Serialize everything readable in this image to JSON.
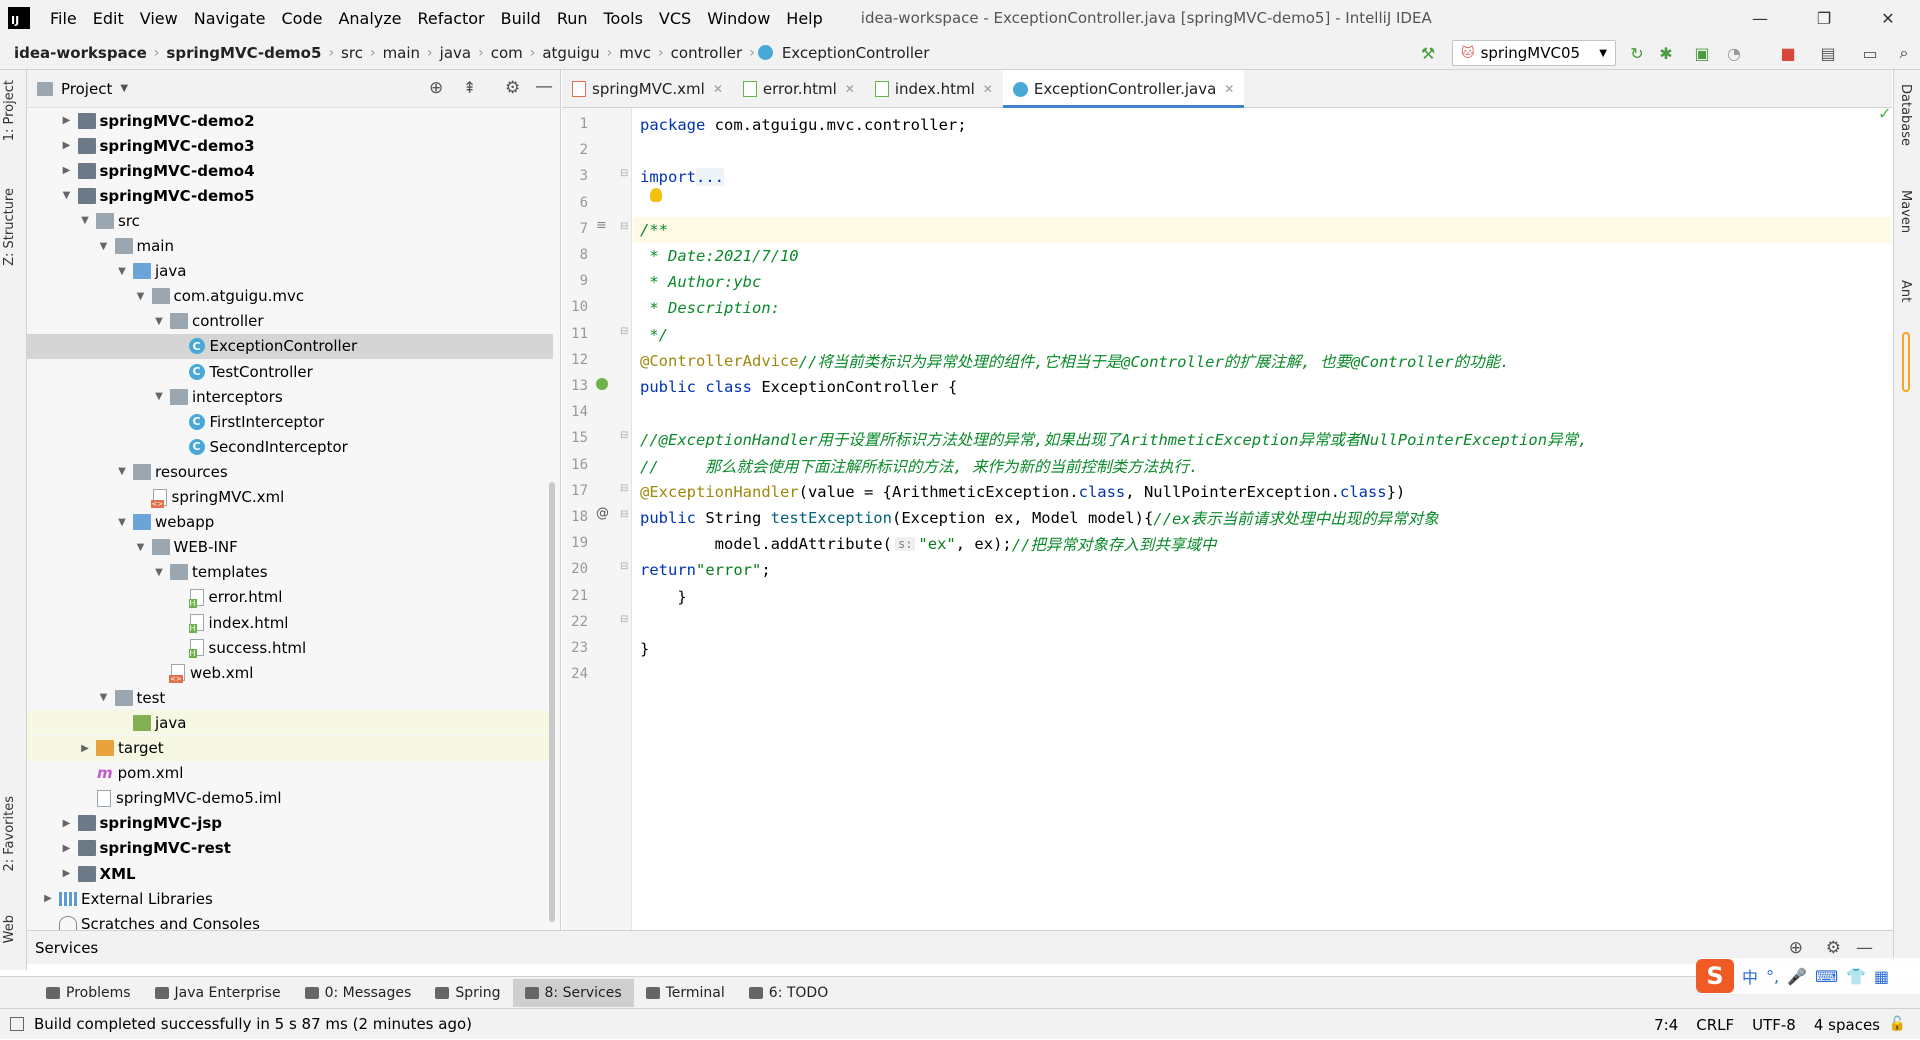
{
  "menubar": {
    "items": [
      "File",
      "Edit",
      "View",
      "Navigate",
      "Code",
      "Analyze",
      "Refactor",
      "Build",
      "Run",
      "Tools",
      "VCS",
      "Window",
      "Help"
    ],
    "title": "idea-workspace - ExceptionController.java [springMVC-demo5] - IntelliJ IDEA",
    "minimize": "—",
    "restore": "❐",
    "close": "✕"
  },
  "breadcrumb": [
    "idea-workspace",
    "springMVC-demo5",
    "src",
    "main",
    "java",
    "com",
    "atguigu",
    "mvc",
    "controller",
    "ExceptionController"
  ],
  "run_config": "springMVC05",
  "project_panel": {
    "title": "Project",
    "tree": [
      {
        "label": "springMVC-demo2",
        "type": "module",
        "depth": 0,
        "arrow": "right",
        "bold": true
      },
      {
        "label": "springMVC-demo3",
        "type": "module",
        "depth": 0,
        "arrow": "right",
        "bold": true
      },
      {
        "label": "springMVC-demo4",
        "type": "module",
        "depth": 0,
        "arrow": "right",
        "bold": true
      },
      {
        "label": "springMVC-demo5",
        "type": "module",
        "depth": 0,
        "arrow": "down",
        "bold": true
      },
      {
        "label": "src",
        "type": "folder",
        "depth": 1,
        "arrow": "down"
      },
      {
        "label": "main",
        "type": "folder",
        "depth": 2,
        "arrow": "down"
      },
      {
        "label": "java",
        "type": "folder-blue",
        "depth": 3,
        "arrow": "down"
      },
      {
        "label": "com.atguigu.mvc",
        "type": "folder",
        "depth": 4,
        "arrow": "down"
      },
      {
        "label": "controller",
        "type": "folder",
        "depth": 5,
        "arrow": "down"
      },
      {
        "label": "ExceptionController",
        "type": "class",
        "depth": 6,
        "arrow": "",
        "selected": true
      },
      {
        "label": "TestController",
        "type": "class",
        "depth": 6,
        "arrow": ""
      },
      {
        "label": "interceptors",
        "type": "folder",
        "depth": 5,
        "arrow": "down"
      },
      {
        "label": "FirstInterceptor",
        "type": "class",
        "depth": 6,
        "arrow": ""
      },
      {
        "label": "SecondInterceptor",
        "type": "class",
        "depth": 6,
        "arrow": ""
      },
      {
        "label": "resources",
        "type": "folder",
        "depth": 3,
        "arrow": "down"
      },
      {
        "label": "springMVC.xml",
        "type": "xml",
        "depth": 4,
        "arrow": ""
      },
      {
        "label": "webapp",
        "type": "folder-blue",
        "depth": 3,
        "arrow": "down"
      },
      {
        "label": "WEB-INF",
        "type": "folder",
        "depth": 4,
        "arrow": "down"
      },
      {
        "label": "templates",
        "type": "folder",
        "depth": 5,
        "arrow": "down"
      },
      {
        "label": "error.html",
        "type": "html",
        "depth": 6,
        "arrow": ""
      },
      {
        "label": "index.html",
        "type": "html",
        "depth": 6,
        "arrow": ""
      },
      {
        "label": "success.html",
        "type": "html",
        "depth": 6,
        "arrow": ""
      },
      {
        "label": "web.xml",
        "type": "xml",
        "depth": 5,
        "arrow": ""
      },
      {
        "label": "test",
        "type": "folder",
        "depth": 2,
        "arrow": "down"
      },
      {
        "label": "java",
        "type": "folder-green",
        "depth": 3,
        "arrow": "",
        "highlight": true
      },
      {
        "label": "target",
        "type": "folder-orange",
        "depth": 1,
        "arrow": "right",
        "highlight": true
      },
      {
        "label": "pom.xml",
        "type": "maven",
        "depth": 1,
        "arrow": ""
      },
      {
        "label": "springMVC-demo5.iml",
        "type": "file",
        "depth": 1,
        "arrow": ""
      },
      {
        "label": "springMVC-jsp",
        "type": "module",
        "depth": 0,
        "arrow": "right",
        "bold": true
      },
      {
        "label": "springMVC-rest",
        "type": "module",
        "depth": 0,
        "arrow": "right",
        "bold": true
      },
      {
        "label": "XML",
        "type": "module",
        "depth": 0,
        "arrow": "right",
        "bold": true
      },
      {
        "label": "External Libraries",
        "type": "lib",
        "depth": -1,
        "arrow": "right"
      },
      {
        "label": "Scratches and Consoles",
        "type": "scratch",
        "depth": -1,
        "arrow": ""
      }
    ]
  },
  "left_tabs": [
    "1: Project",
    "Z: Structure",
    "2: Favorites",
    "Web"
  ],
  "right_tabs": [
    "Database",
    "Maven",
    "Ant"
  ],
  "editor_tabs": [
    {
      "label": "springMVC.xml",
      "icon": "xml"
    },
    {
      "label": "error.html",
      "icon": "html"
    },
    {
      "label": "index.html",
      "icon": "html"
    },
    {
      "label": "ExceptionController.java",
      "icon": "java",
      "active": true
    }
  ],
  "code_lines": [
    {
      "n": "1",
      "html": "<span class=\"kw\">package</span> com.atguigu.mvc.controller;"
    },
    {
      "n": "2",
      "html": ""
    },
    {
      "n": "3",
      "html": "<span class=\"kw\">import</span> <span class=\"fold\">...</span>"
    },
    {
      "n": "6",
      "html": ""
    },
    {
      "n": "7",
      "html": "<span class=\"doc\">/**</span>",
      "caret": true
    },
    {
      "n": "8",
      "html": "<span class=\"doc\"> * Date:2021/7/10</span>"
    },
    {
      "n": "9",
      "html": "<span class=\"doc\"> * Author:ybc</span>"
    },
    {
      "n": "10",
      "html": "<span class=\"doc\"> * Description:</span>"
    },
    {
      "n": "11",
      "html": "<span class=\"doc\"> */</span>"
    },
    {
      "n": "12",
      "html": "<span class=\"ann\">@ControllerAdvice</span> <span class=\"cm\">//将当前类标识为异常处理的组件,它相当于是@Controller的扩展注解, 也要@Controller的功能.</span>"
    },
    {
      "n": "13",
      "html": "<span class=\"kw\">public class</span> ExceptionController {"
    },
    {
      "n": "14",
      "html": ""
    },
    {
      "n": "15",
      "html": "    <span class=\"cm\">//@ExceptionHandler用于设置所标识方法处理的异常,如果出现了ArithmeticException异常或者NullPointerException异常,</span>"
    },
    {
      "n": "16",
      "html": "    <span class=\"cm\">//     那么就会使用下面注解所标识的方法, 来作为新的当前控制类方法执行.</span>"
    },
    {
      "n": "17",
      "html": "    <span class=\"ann\">@ExceptionHandler</span>(value = {ArithmeticException.<span class=\"kw\">class</span>, NullPointerException.<span class=\"kw\">class</span>})"
    },
    {
      "n": "18",
      "html": "    <span class=\"kw\">public</span> String <span class=\"fn\">testException</span>(Exception ex, Model model){<span class=\"cm\">//ex表示当前请求处理中出现的异常对象</span>"
    },
    {
      "n": "19",
      "html": "        model.addAttribute(<span class=\"hint\">s:</span><span class=\"str\">\"ex\"</span>, ex);<span class=\"cm\">//把异常对象存入到共享域中</span>"
    },
    {
      "n": "20",
      "html": "        <span class=\"kw\">return</span> <span class=\"str\">\"error\"</span>;"
    },
    {
      "n": "21",
      "html": "    }"
    },
    {
      "n": "22",
      "html": ""
    },
    {
      "n": "23",
      "html": "}"
    },
    {
      "n": "24",
      "html": ""
    }
  ],
  "services_label": "Services",
  "tool_windows": [
    {
      "label": "Problems"
    },
    {
      "label": "Java Enterprise"
    },
    {
      "label": "0: Messages"
    },
    {
      "label": "Spring"
    },
    {
      "label": "8: Services",
      "active": true
    },
    {
      "label": "Terminal"
    },
    {
      "label": "6: TODO"
    }
  ],
  "status": {
    "message": "Build completed successfully in 5 s 87 ms (2 minutes ago)",
    "position": "7:4",
    "line_sep": "CRLF",
    "encoding": "UTF-8",
    "indent": "4 spaces"
  },
  "ime": {
    "logo": "S",
    "mode": "中"
  },
  "colors": {
    "accent": "#4083c9",
    "keyword": "#0033b3",
    "comment": "#0a8a2a",
    "annotation": "#9e880d",
    "string": "#067d17"
  }
}
